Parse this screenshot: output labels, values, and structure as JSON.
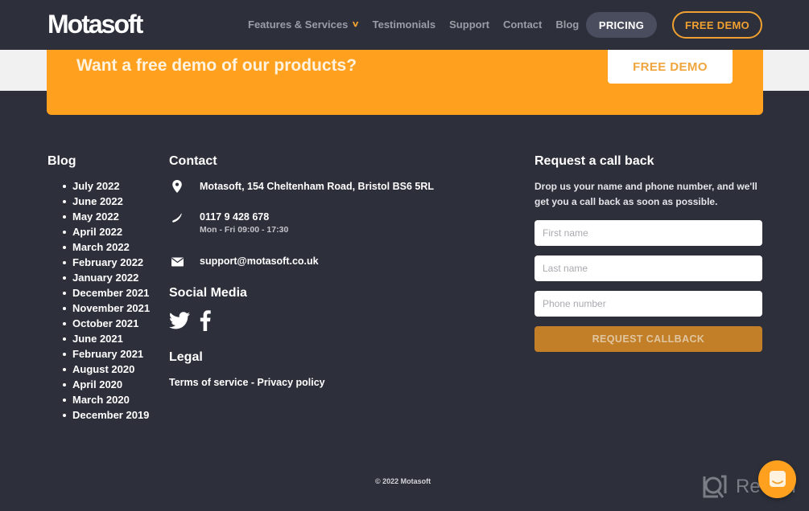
{
  "header": {
    "logo": "Motasoft",
    "nav": [
      {
        "label": "Features & Services",
        "has_dropdown": true
      },
      {
        "label": "Testimonials"
      },
      {
        "label": "Support"
      },
      {
        "label": "Contact"
      },
      {
        "label": "Blog"
      }
    ],
    "pricing_label": "PRICING",
    "free_demo_label": "FREE DEMO"
  },
  "banner": {
    "title": "Want a free demo of our products?",
    "button_label": "FREE DEMO"
  },
  "blog": {
    "title": "Blog",
    "items": [
      "July 2022",
      "June 2022",
      "May 2022",
      "April 2022",
      "March 2022",
      "February 2022",
      "January 2022",
      "December 2021",
      "November 2021",
      "October 2021",
      "June 2021",
      "February 2021",
      "August 2020",
      "April 2020",
      "March 2020",
      "December 2019"
    ]
  },
  "contact": {
    "title": "Contact",
    "address": "Motasoft, 154 Cheltenham Road, Bristol BS6 5RL",
    "phone": "0117 9 428 678",
    "hours": "Mon - Fri 09:00 - 17:30",
    "email": "support@motasoft.co.uk"
  },
  "social": {
    "title": "Social Media",
    "icons": [
      "twitter-icon",
      "facebook-icon"
    ]
  },
  "legal": {
    "title": "Legal",
    "terms": "Terms of service",
    "separator": " - ",
    "privacy": "Privacy policy"
  },
  "callback": {
    "title": "Request a call back",
    "description": "Drop us your name and phone number, and we'll get you a call back as soon as possible.",
    "first_name_placeholder": "First name",
    "last_name_placeholder": "Last name",
    "phone_placeholder": "Phone number",
    "button_label": "REQUEST CALLBACK"
  },
  "footer": {
    "copyright": "© 2022 Motasoft",
    "watermark": "Revain"
  },
  "colors": {
    "accent": "#ffa11f",
    "background": "#2d2f3a",
    "callback_button": "#c27f28"
  }
}
